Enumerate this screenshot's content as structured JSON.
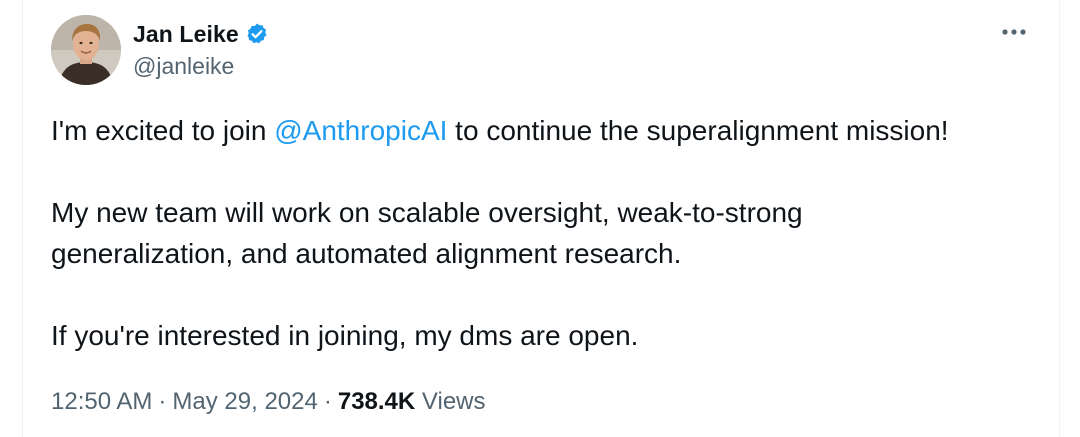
{
  "author": {
    "display_name": "Jan Leike",
    "handle": "@janleike",
    "verified_color": "#1d9bf0"
  },
  "tweet": {
    "line1_before": "I'm excited to join ",
    "mention": "@AnthropicAI",
    "line1_after": " to continue the superalignment mission!",
    "paragraph2_line1": "My new team will work on scalable oversight, weak-to-strong",
    "paragraph2_line2": "generalization, and automated alignment research.",
    "paragraph3": "If you're interested in joining, my dms are open."
  },
  "meta": {
    "time": "12:50 AM",
    "separator": "·",
    "date": "May 29, 2024",
    "views_count": "738.4K",
    "views_label": "Views"
  },
  "colors": {
    "text_primary": "#0f1419",
    "text_secondary": "#536471",
    "link": "#1d9bf0"
  },
  "icons": {
    "verified": "verified-badge-icon",
    "more": "more-dots-icon"
  }
}
